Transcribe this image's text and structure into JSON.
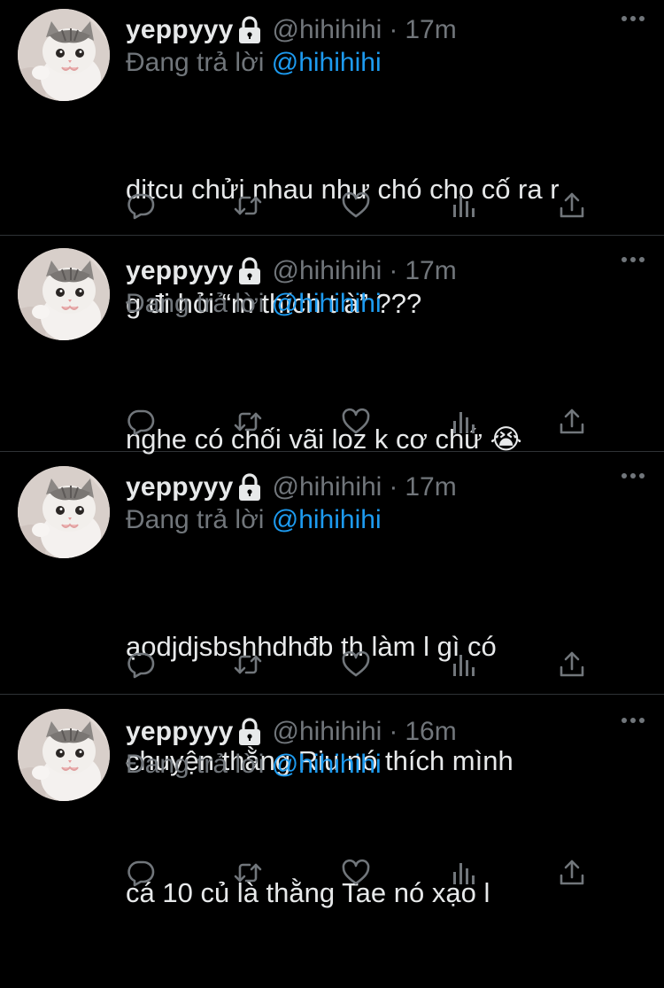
{
  "colors": {
    "background": "#000000",
    "text_primary": "#e7e9ea",
    "text_secondary": "#71767b",
    "link": "#1d9bf0",
    "divider": "#2f3336"
  },
  "icons": {
    "lock": "lock-icon",
    "more": "more-icon",
    "reply": "reply-icon",
    "retweet": "retweet-icon",
    "like": "heart-icon",
    "views": "analytics-icon",
    "share": "share-icon"
  },
  "tweets": [
    {
      "display_name": "yeppyyy",
      "handle": "@hihihihi",
      "separator": "·",
      "time": "17m",
      "reply_prefix": "Đang trả lời",
      "reply_to": "@hihihihi",
      "text_lines": [
        "ditcu chửi nhau như chó cho cố ra r",
        "g đi hỏi “m thích t à” ???"
      ]
    },
    {
      "display_name": "yeppyyy",
      "handle": "@hihihihi",
      "separator": "·",
      "time": "17m",
      "reply_prefix": "Đang trả lời",
      "reply_to": "@hihihihi",
      "text_lines": [
        "nghe có chối vãi loz k cơ chứ 😭"
      ]
    },
    {
      "display_name": "yeppyyy",
      "handle": "@hihihihi",
      "separator": "·",
      "time": "17m",
      "reply_prefix": "Đang trả lời",
      "reply_to": "@hihihihi",
      "text_lines": [
        "ạodjdjsbshhdhđb th làm l gì có",
        "chuyện thằng Riu nó thích mình"
      ]
    },
    {
      "display_name": "yeppyyy",
      "handle": "@hihihihi",
      "separator": "·",
      "time": "16m",
      "reply_prefix": "Đang trả lời",
      "reply_to": "@hihihihi",
      "text_lines": [
        "cá 10 củ là thằng Tae nó xạo l"
      ]
    }
  ]
}
